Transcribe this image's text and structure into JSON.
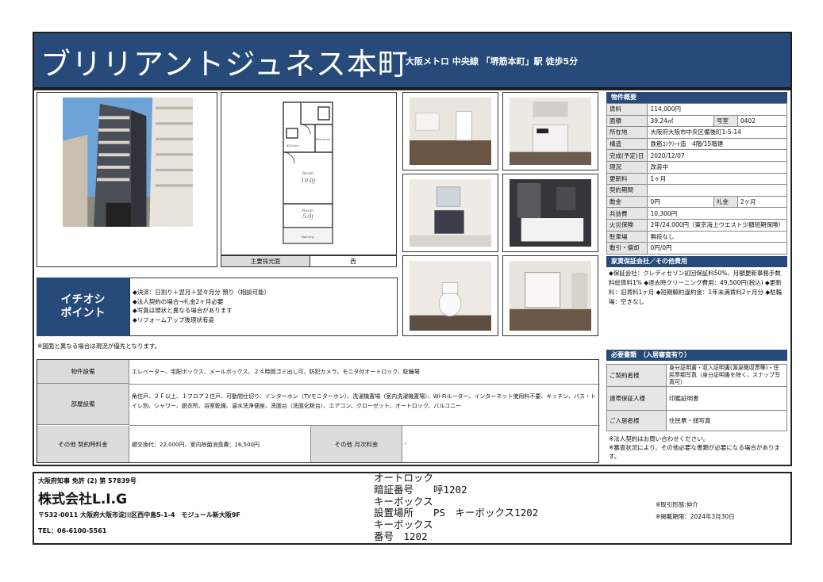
{
  "header": {
    "title": "ブリリアントジュネス本町",
    "station": "大阪メトロ 中央線 「堺筋本町」駅 徒歩5分"
  },
  "floorplan": {
    "direction_label": "主要採光面",
    "direction_value": "西",
    "room_labels": [
      "洋室",
      "10.0帖",
      "洋室",
      "5.0帖",
      "Kitchen",
      "Entrance",
      "Balcony"
    ]
  },
  "overview": {
    "title": "物件概要",
    "rows": [
      {
        "label": "賃料",
        "value": "114,000円"
      },
      {
        "label": "面積",
        "value": "39.24㎡",
        "label2": "号室",
        "value2": "0402"
      },
      {
        "label": "所在地",
        "value": "大阪府大阪市中央区備後町1-5-14"
      },
      {
        "label": "構造",
        "value": "鉄筋ｺﾝｸﾘｰﾄ造　4階/15階建"
      },
      {
        "label": "完成(予定)日",
        "value": "2020/12/07"
      },
      {
        "label": "現況",
        "value": "改装中"
      },
      {
        "label": "更新料",
        "value": "1ヶ月"
      },
      {
        "label": "契約期間",
        "value": ""
      },
      {
        "label": "敷金",
        "value": "0円",
        "label2": "礼金",
        "value2": "2ヶ月"
      },
      {
        "label": "共益費",
        "value": "10,300円"
      },
      {
        "label": "火災保険",
        "value": "2年/24,000円（東京海上ウエスト少額短期保険）"
      },
      {
        "label": "駐車場",
        "value": "無段なし"
      },
      {
        "label": "敷引・償却",
        "value": "0円/0円"
      }
    ]
  },
  "guarantee": {
    "title": "家賃保証会社／その他費用",
    "text": "◆保証会社：クレディセゾン初回保証料50%、月額更新事務手数料総賃料1% ◆退去時クリーニング費用：49,500円(税込) ◆更新料：旧賃料1ヶ月 ◆短期解約違約金：1年未満賃料2ヶ月分 ◆駐輪場：空きなし"
  },
  "required_docs": {
    "title": "必要書類　（入居審査有り）",
    "rows": [
      {
        "label": "ご契約者様",
        "value": "身分証明書・収入証明書(源泉徴収票等)・住民票類写真（身分証明書を除く、スナップ写真可）"
      },
      {
        "label": "連帯保証人様",
        "value": "印鑑証明書"
      },
      {
        "label": "ご入居者様",
        "value": "住民票・顔写真"
      }
    ],
    "notes": [
      "※法人契約はお問い合わせください。",
      "※審査状況により、その他必要な書類が必要になる場合があります。"
    ]
  },
  "points": {
    "title_line1": "イチオシ",
    "title_line2": "ポイント",
    "items": [
      "◆決済：日割り＋翌月＋翌々月分 預り（相談可能）",
      "◆法人契約の場合→礼金2ヶ月必要",
      "◆写真は現状と異なる場合があります",
      "◆リフォームアップ後現状有姿"
    ]
  },
  "note": "※図面と異なる場合は現況が優先となります。",
  "facilities": {
    "building_label": "物件設備",
    "building_value": "エレベーター、宅配ボックス、メールボックス、２４時間ゴミ出し可、防犯カメラ、モニタ付オートロック、駐輪場",
    "room_label": "部屋設備",
    "room_value": "角住戸、２Ｆ以上、１フロア２住戸、可動間仕切り、インターホン（TVモニターホン）、洗濯機置場（室内洗濯機置場）、Wi-Fiルーター、インターネット使用料不要、キッチン、バス・トイレ別、シャワー、脱衣所、浴室乾燥、温水洗浄便座、洗面台（洗面化粧台）、エアコン、クローゼット、オートロック、バルコニー",
    "other_contract_label": "その他 契約時料金",
    "other_contract_value": "鍵交換代：22,000円、室内除菌消臭費：16,500円",
    "other_monthly_label": "その他 月次料金",
    "other_monthly_value": "-"
  },
  "footer": {
    "license": "大阪府知事 免許 (2) 第 57839号",
    "company": "株式会社L.I.G",
    "address": "〒532-0011 大阪府大阪市淀川区西中島5-1-4　モジュール新大阪9F",
    "tel": "TEL：06-6100-5561",
    "keybox_lines": [
      "オートロック",
      "暗証番号　　呼1202",
      "キーボックス",
      "設置場所　　PS　キーボックス1202",
      "キーボックス",
      "番号　1202"
    ],
    "transaction": "※取引形態:仲介",
    "published": "※掲載期限：2024年3月30日"
  }
}
